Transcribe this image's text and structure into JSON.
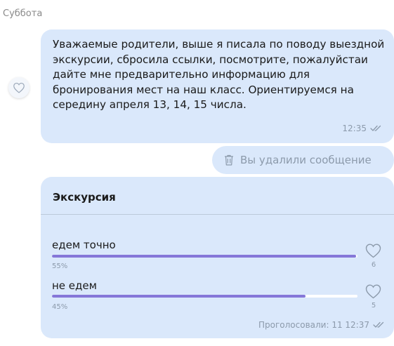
{
  "day_label": "Суббота",
  "message": {
    "text": "Уважаемые родители, выше я писала по поводу выездной экскурсии, сбросила ссылки, посмотрите, пожалуйстаи дайте мне предварительно информацию для бронирования мест на наш класс. Ориентируемся на середину апреля 13, 14, 15 числа.",
    "time": "12:35",
    "status_icon": "double-check-icon"
  },
  "deleted_message": {
    "icon": "trash-icon",
    "text": "Вы удалили сообщение"
  },
  "poll": {
    "title": "Экскурсия",
    "options": [
      {
        "label": "едем точно",
        "percent_label": "55%",
        "fill": 0.995,
        "votes": "6"
      },
      {
        "label": "не едем",
        "percent_label": "45%",
        "fill": 0.83,
        "votes": "5"
      }
    ],
    "footer": "Проголосовали: 11 12:37",
    "status_icon": "double-check-icon"
  },
  "colors": {
    "bubble": "#dae8fb",
    "accent_bar": "#8577d8",
    "meta_text": "#8c9aab"
  }
}
